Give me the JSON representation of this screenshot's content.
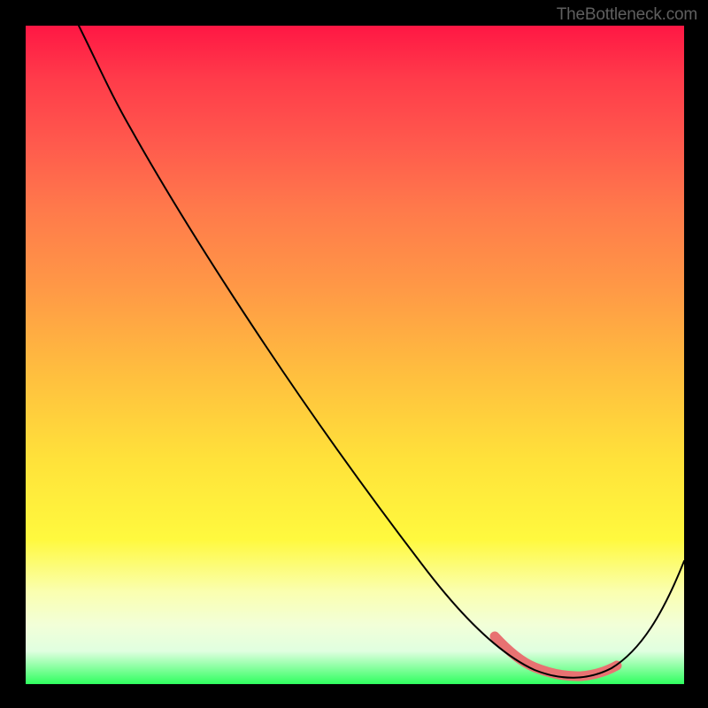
{
  "attribution": "TheBottleneck.com",
  "chart_data": {
    "type": "line",
    "title": "",
    "xlabel": "",
    "ylabel": "",
    "x_range": [
      0,
      100
    ],
    "y_range": [
      0,
      100
    ],
    "note": "Bottleneck-style curve on a green→red threat gradient. X is a relative component ratio (0–100). Y is bottleneck severity (0 = no bottleneck, 100 = maximal). No numeric axis ticks are shown; values are read off relative position.",
    "series": [
      {
        "name": "bottleneck-curve",
        "x": [
          0,
          5,
          10,
          16,
          22,
          28,
          34,
          40,
          46,
          52,
          58,
          64,
          69,
          73,
          77,
          81,
          85,
          88,
          91,
          94,
          97,
          100
        ],
        "y_severity": [
          100,
          98,
          95,
          91,
          85,
          78,
          70,
          62,
          54,
          45,
          37,
          28,
          20,
          13,
          7,
          3,
          1,
          0,
          0,
          3,
          10,
          22
        ]
      },
      {
        "name": "safe-zone-highlight",
        "x": [
          72,
          76,
          80,
          84,
          88,
          91
        ],
        "y_severity": [
          7,
          3,
          1,
          0,
          0,
          2
        ]
      }
    ],
    "gradient_stops_pct_to_color": {
      "0": "#ff1744",
      "50": "#ffbc3f",
      "85": "#fff93e",
      "100": "#2fff5f"
    }
  }
}
